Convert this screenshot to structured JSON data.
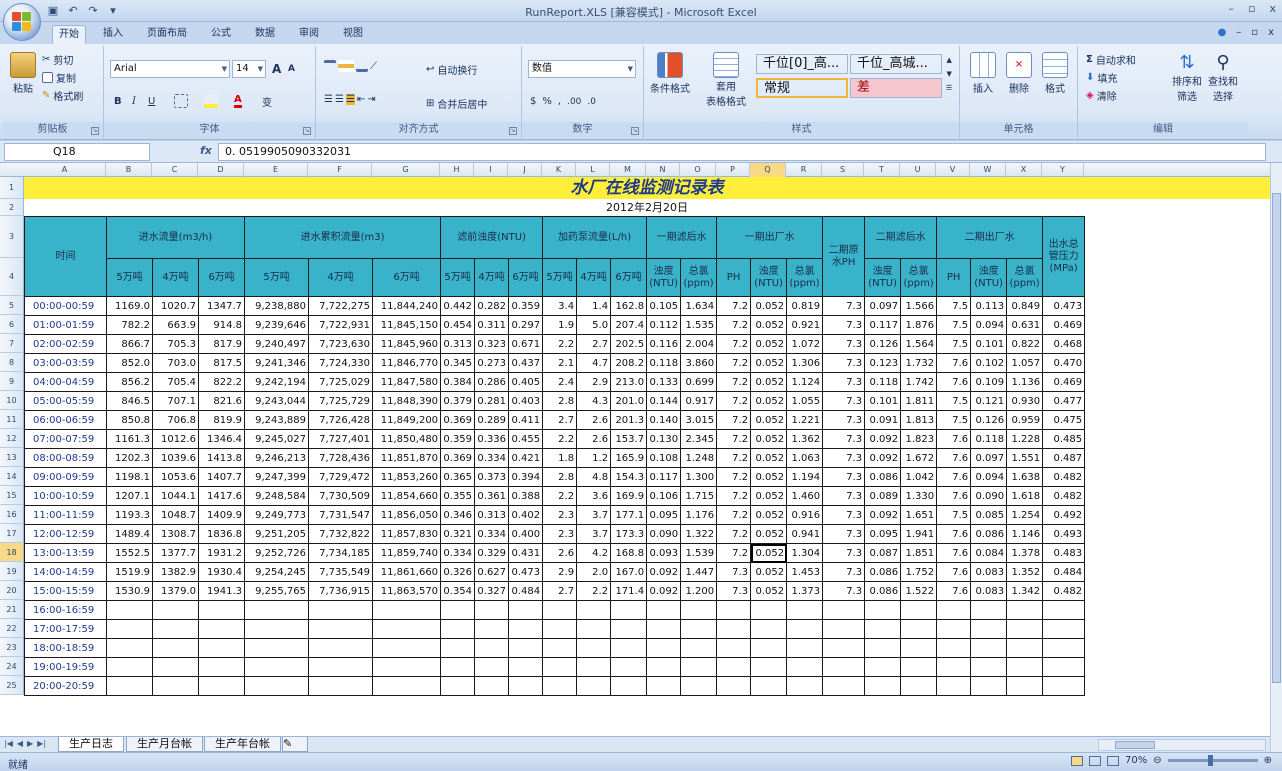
{
  "window": {
    "title": "RunReport.XLS  [兼容模式] - Microsoft Excel",
    "minimize": "–",
    "maximize": "▫",
    "close": "x"
  },
  "ribbon_tabs": [
    "开始",
    "插入",
    "页面布局",
    "公式",
    "数据",
    "审阅",
    "视图"
  ],
  "help_controls": [
    "●",
    "–",
    "▫",
    "x"
  ],
  "clipboard": {
    "label": "剪贴板",
    "paste": "粘贴",
    "cut": "剪切",
    "copy": "复制",
    "format_painter": "格式刷"
  },
  "font": {
    "label": "字体",
    "name": "Arial",
    "size": "14",
    "bold": "B",
    "italic": "I",
    "underline": "U",
    "grow": "A",
    "shrink": "A",
    "phonetic": "变"
  },
  "alignment": {
    "label": "对齐方式",
    "wrap_text": "自动换行",
    "merge_center": "合并后居中"
  },
  "number": {
    "label": "数字",
    "format": "数值",
    "percent": "%",
    "comma": ",",
    "inc_decimal": ".00",
    "dec_decimal": ".0"
  },
  "styles": {
    "label": "样式",
    "conditional": "条件格式",
    "table_format_line1": "套用",
    "table_format_line2": "表格格式",
    "cell_styles": [
      {
        "text": "千位[0]_高...",
        "bg": "#ffffff",
        "color": "#111111"
      },
      {
        "text": "千位_高城...",
        "bg": "#ffffff",
        "color": "#111111"
      },
      {
        "text": "常规",
        "bg": "#ffffff",
        "color": "#111111"
      },
      {
        "text": "差",
        "bg": "#f6c7ce",
        "color": "#9c0006"
      }
    ]
  },
  "cells_group": {
    "label": "单元格",
    "insert": "插入",
    "delete": "删除",
    "format": "格式"
  },
  "editing": {
    "label": "编辑",
    "autosum": "自动求和",
    "fill": "填充",
    "clear": "清除",
    "sort_filter_1": "排序和",
    "sort_filter_2": "筛选",
    "find_1": "查找和",
    "find_2": "选择"
  },
  "formula_bar": {
    "name_box": "Q18",
    "fx": "fx",
    "value": "0. 0519905090332031"
  },
  "columns": [
    "A",
    "B",
    "C",
    "D",
    "E",
    "F",
    "G",
    "H",
    "I",
    "J",
    "K",
    "L",
    "M",
    "N",
    "O",
    "P",
    "Q",
    "R",
    "S",
    "T",
    "U",
    "V",
    "W",
    "X",
    "Y"
  ],
  "selected_column": "Q",
  "row_numbers": [
    "1",
    "2",
    "3",
    "4",
    "5",
    "6",
    "7",
    "8",
    "9",
    "10",
    "11",
    "12",
    "13",
    "14",
    "15",
    "16",
    "17",
    "18",
    "19",
    "20",
    "21",
    "22",
    "23",
    "24",
    "25"
  ],
  "selected_row": "18",
  "report": {
    "title": "水厂在线监测记录表",
    "date": "2012年2月20日",
    "header": {
      "time": "时间",
      "inflow": "进水流量(m3/h)",
      "cumulative": "进水累积流量(m3)",
      "turbidity": "滤前浊度(NTU)",
      "dosing": "加药泵流量(L/h)",
      "phase1_filtered": "一期滤后水",
      "phase1_outflow": "一期出厂水",
      "phase2_raw_ph": "二期原水PH",
      "phase2_filtered": "二期滤后水",
      "phase2_outflow": "二期出厂水",
      "pressure": "出水总管压力(MPa)"
    },
    "sub": {
      "t5": "5万吨",
      "t4": "4万吨",
      "t6": "6万吨",
      "turb": "浊度(NTU)",
      "chlorine": "总氯(ppm)",
      "ph": "PH"
    },
    "rows": [
      [
        "00:00-00:59",
        "1169.0",
        "1020.7",
        "1347.7",
        "9,238,880",
        "7,722,275",
        "11,844,240",
        "0.442",
        "0.282",
        "0.359",
        "3.4",
        "1.4",
        "162.8",
        "0.105",
        "1.634",
        "7.2",
        "0.052",
        "0.819",
        "7.3",
        "0.097",
        "1.566",
        "7.5",
        "0.113",
        "0.849",
        "0.473"
      ],
      [
        "01:00-01:59",
        "782.2",
        "663.9",
        "914.8",
        "9,239,646",
        "7,722,931",
        "11,845,150",
        "0.454",
        "0.311",
        "0.297",
        "1.9",
        "5.0",
        "207.4",
        "0.112",
        "1.535",
        "7.2",
        "0.052",
        "0.921",
        "7.3",
        "0.117",
        "1.876",
        "7.5",
        "0.094",
        "0.631",
        "0.469"
      ],
      [
        "02:00-02:59",
        "866.7",
        "705.3",
        "817.9",
        "9,240,497",
        "7,723,630",
        "11,845,960",
        "0.313",
        "0.323",
        "0.671",
        "2.2",
        "2.7",
        "202.5",
        "0.116",
        "2.004",
        "7.2",
        "0.052",
        "1.072",
        "7.3",
        "0.126",
        "1.564",
        "7.5",
        "0.101",
        "0.822",
        "0.468"
      ],
      [
        "03:00-03:59",
        "852.0",
        "703.0",
        "817.5",
        "9,241,346",
        "7,724,330",
        "11,846,770",
        "0.345",
        "0.273",
        "0.437",
        "2.1",
        "4.7",
        "208.2",
        "0.118",
        "3.860",
        "7.2",
        "0.052",
        "1.306",
        "7.3",
        "0.123",
        "1.732",
        "7.6",
        "0.102",
        "1.057",
        "0.470"
      ],
      [
        "04:00-04:59",
        "856.2",
        "705.4",
        "822.2",
        "9,242,194",
        "7,725,029",
        "11,847,580",
        "0.384",
        "0.286",
        "0.405",
        "2.4",
        "2.9",
        "213.0",
        "0.133",
        "0.699",
        "7.2",
        "0.052",
        "1.124",
        "7.3",
        "0.118",
        "1.742",
        "7.6",
        "0.109",
        "1.136",
        "0.469"
      ],
      [
        "05:00-05:59",
        "846.5",
        "707.1",
        "821.6",
        "9,243,044",
        "7,725,729",
        "11,848,390",
        "0.379",
        "0.281",
        "0.403",
        "2.8",
        "4.3",
        "201.0",
        "0.144",
        "0.917",
        "7.2",
        "0.052",
        "1.055",
        "7.3",
        "0.101",
        "1.811",
        "7.5",
        "0.121",
        "0.930",
        "0.477"
      ],
      [
        "06:00-06:59",
        "850.8",
        "706.8",
        "819.9",
        "9,243,889",
        "7,726,428",
        "11,849,200",
        "0.369",
        "0.289",
        "0.411",
        "2.7",
        "2.6",
        "201.3",
        "0.140",
        "3.015",
        "7.2",
        "0.052",
        "1.221",
        "7.3",
        "0.091",
        "1.813",
        "7.5",
        "0.126",
        "0.959",
        "0.475"
      ],
      [
        "07:00-07:59",
        "1161.3",
        "1012.6",
        "1346.4",
        "9,245,027",
        "7,727,401",
        "11,850,480",
        "0.359",
        "0.336",
        "0.455",
        "2.2",
        "2.6",
        "153.7",
        "0.130",
        "2.345",
        "7.2",
        "0.052",
        "1.362",
        "7.3",
        "0.092",
        "1.823",
        "7.6",
        "0.118",
        "1.228",
        "0.485"
      ],
      [
        "08:00-08:59",
        "1202.3",
        "1039.6",
        "1413.8",
        "9,246,213",
        "7,728,436",
        "11,851,870",
        "0.369",
        "0.334",
        "0.421",
        "1.8",
        "1.2",
        "165.9",
        "0.108",
        "1.248",
        "7.2",
        "0.052",
        "1.063",
        "7.3",
        "0.092",
        "1.672",
        "7.6",
        "0.097",
        "1.551",
        "0.487"
      ],
      [
        "09:00-09:59",
        "1198.1",
        "1053.6",
        "1407.7",
        "9,247,399",
        "7,729,472",
        "11,853,260",
        "0.365",
        "0.373",
        "0.394",
        "2.8",
        "4.8",
        "154.3",
        "0.117",
        "1.300",
        "7.2",
        "0.052",
        "1.194",
        "7.3",
        "0.086",
        "1.042",
        "7.6",
        "0.094",
        "1.638",
        "0.482"
      ],
      [
        "10:00-10:59",
        "1207.1",
        "1044.1",
        "1417.6",
        "9,248,584",
        "7,730,509",
        "11,854,660",
        "0.355",
        "0.361",
        "0.388",
        "2.2",
        "3.6",
        "169.9",
        "0.106",
        "1.715",
        "7.2",
        "0.052",
        "1.460",
        "7.3",
        "0.089",
        "1.330",
        "7.6",
        "0.090",
        "1.618",
        "0.482"
      ],
      [
        "11:00-11:59",
        "1193.3",
        "1048.7",
        "1409.9",
        "9,249,773",
        "7,731,547",
        "11,856,050",
        "0.346",
        "0.313",
        "0.402",
        "2.3",
        "3.7",
        "177.1",
        "0.095",
        "1.176",
        "7.2",
        "0.052",
        "0.916",
        "7.3",
        "0.092",
        "1.651",
        "7.5",
        "0.085",
        "1.254",
        "0.492"
      ],
      [
        "12:00-12:59",
        "1489.4",
        "1308.7",
        "1836.8",
        "9,251,205",
        "7,732,822",
        "11,857,830",
        "0.321",
        "0.334",
        "0.400",
        "2.3",
        "3.7",
        "173.3",
        "0.090",
        "1.322",
        "7.2",
        "0.052",
        "0.941",
        "7.3",
        "0.095",
        "1.941",
        "7.6",
        "0.086",
        "1.146",
        "0.493"
      ],
      [
        "13:00-13:59",
        "1552.5",
        "1377.7",
        "1931.2",
        "9,252,726",
        "7,734,185",
        "11,859,740",
        "0.334",
        "0.329",
        "0.431",
        "2.6",
        "4.2",
        "168.8",
        "0.093",
        "1.539",
        "7.2",
        "0.052",
        "1.304",
        "7.3",
        "0.087",
        "1.851",
        "7.6",
        "0.084",
        "1.378",
        "0.483"
      ],
      [
        "14:00-14:59",
        "1519.9",
        "1382.9",
        "1930.4",
        "9,254,245",
        "7,735,549",
        "11,861,660",
        "0.326",
        "0.627",
        "0.473",
        "2.9",
        "2.0",
        "167.0",
        "0.092",
        "1.447",
        "7.3",
        "0.052",
        "1.453",
        "7.3",
        "0.086",
        "1.752",
        "7.6",
        "0.083",
        "1.352",
        "0.484"
      ],
      [
        "15:00-15:59",
        "1530.9",
        "1379.0",
        "1941.3",
        "9,255,765",
        "7,736,915",
        "11,863,570",
        "0.354",
        "0.327",
        "0.484",
        "2.7",
        "2.2",
        "171.4",
        "0.092",
        "1.200",
        "7.3",
        "0.052",
        "1.373",
        "7.3",
        "0.086",
        "1.522",
        "7.6",
        "0.083",
        "1.342",
        "0.482"
      ],
      [
        "16:00-16:59"
      ],
      [
        "17:00-17:59"
      ],
      [
        "18:00-18:59"
      ],
      [
        "19:00-19:59"
      ],
      [
        "20:00-20:59"
      ]
    ],
    "active_cell": {
      "row": 13,
      "col": 16
    }
  },
  "sheet_tabs": [
    "生产日志",
    "生产月台帐",
    "生产年台帐"
  ],
  "active_sheet": 0,
  "status": {
    "text": "就绪",
    "zoom": "70%"
  }
}
